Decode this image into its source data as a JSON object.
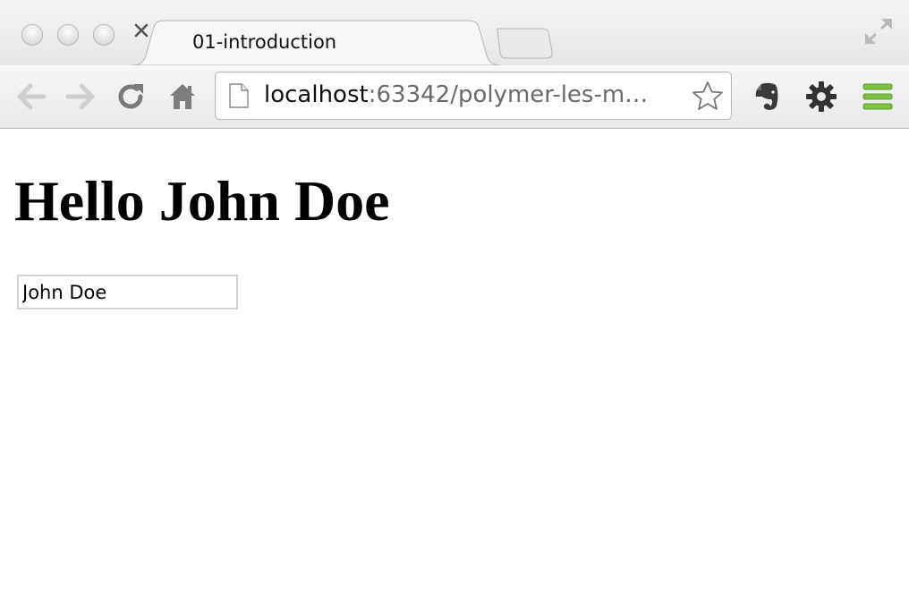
{
  "window": {
    "tab": {
      "title": "01-introduction",
      "close_glyph": "×"
    }
  },
  "toolbar": {
    "address": {
      "host": "localhost",
      "rest": ":63342/polymer-les-m…"
    },
    "icons": {
      "back": "back-arrow-icon",
      "forward": "forward-arrow-icon",
      "reload": "reload-icon",
      "home": "home-icon",
      "page": "page-icon",
      "bookmark": "star-icon",
      "evernote": "evernote-icon",
      "settings": "gear-icon",
      "menu": "hamburger-menu-icon"
    }
  },
  "page": {
    "heading": "Hello John Doe",
    "name_input": {
      "value": "John Doe"
    }
  },
  "colors": {
    "menu_accent": "#7dc245",
    "url_host": "#111111",
    "url_rest": "#6a6a6a"
  }
}
